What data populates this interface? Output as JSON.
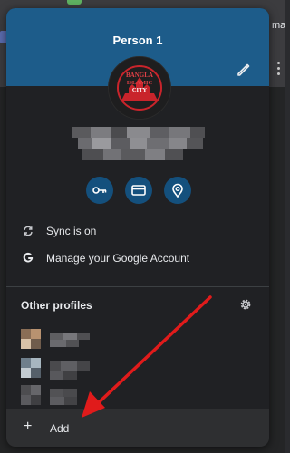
{
  "profile": {
    "name": "Person 1",
    "avatar_text_line1": "BANGLA",
    "avatar_text_line2": "ISLAMIC",
    "avatar_text_line3": "CITY"
  },
  "quick_actions": [
    {
      "name": "passwords",
      "icon": "key-icon"
    },
    {
      "name": "payment-methods",
      "icon": "credit-card-icon"
    },
    {
      "name": "addresses",
      "icon": "location-pin-icon"
    }
  ],
  "menu": {
    "sync_label": "Sync is on",
    "manage_account_label": "Manage your Google Account"
  },
  "other_profiles": {
    "title": "Other profiles"
  },
  "add": {
    "label": "Add"
  },
  "colors": {
    "header": "#1d5c8a",
    "popup_bg": "#202124",
    "quick_action_bg": "#14507d",
    "arrow": "#e01b1b"
  },
  "browser": {
    "right_edge_text": "mar"
  }
}
